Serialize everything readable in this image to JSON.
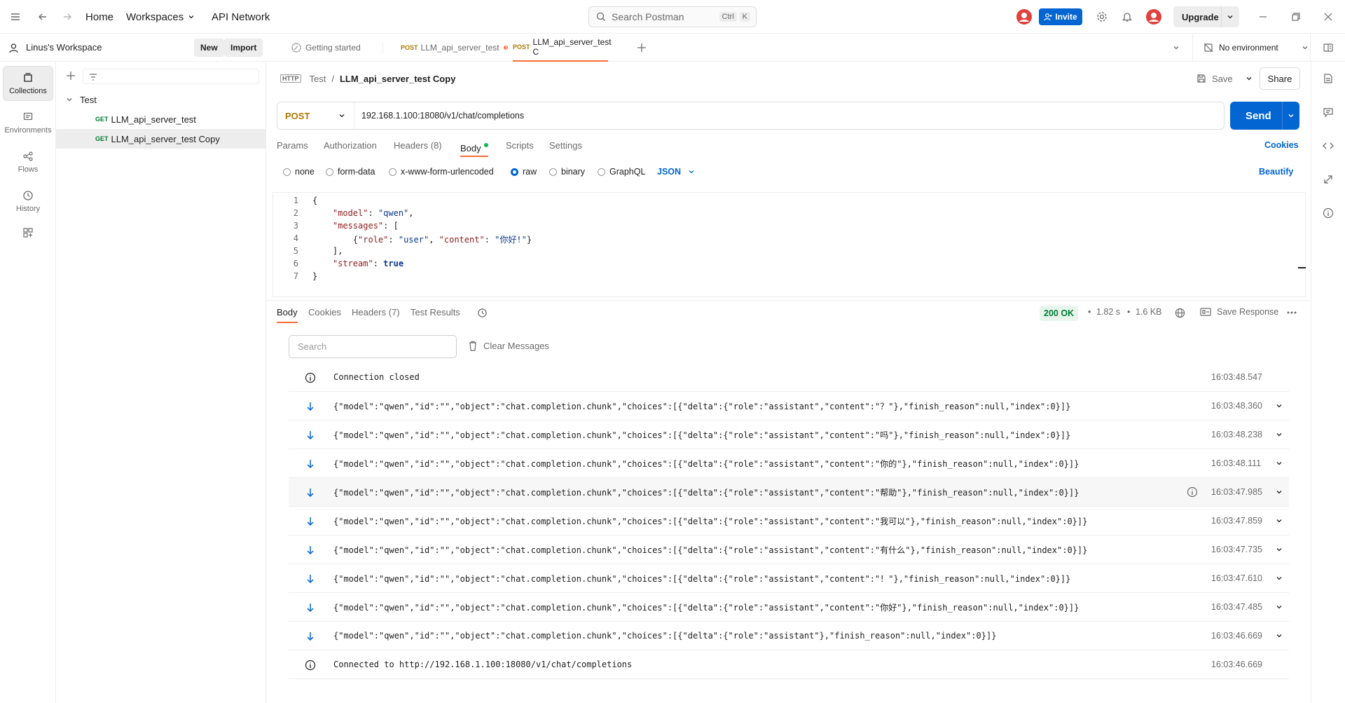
{
  "topbar": {
    "home": "Home",
    "workspaces": "Workspaces",
    "api_network": "API Network",
    "search_placeholder": "Search Postman",
    "kbd_ctrl": "Ctrl",
    "kbd_k": "K",
    "invite": "Invite",
    "upgrade": "Upgrade"
  },
  "rail": {
    "collections": "Collections",
    "environments": "Environments",
    "flows": "Flows",
    "history": "History"
  },
  "sidebar": {
    "workspace_name": "Linus's Workspace",
    "new_label": "New",
    "import_label": "Import",
    "collection": "Test",
    "items": [
      {
        "method": "GET",
        "name": "LLM_api_server_test"
      },
      {
        "method": "GET",
        "name": "LLM_api_server_test Copy"
      }
    ]
  },
  "tabs": [
    {
      "method": "",
      "label": "Getting started"
    },
    {
      "method": "POST",
      "label": "LLM_api_server_test"
    },
    {
      "method": "POST",
      "label": "LLM_api_server_test C"
    }
  ],
  "environment": "No environment",
  "request": {
    "breadcrumb_parent": "Test",
    "breadcrumb_sep": "/",
    "title": "LLM_api_server_test Copy",
    "save": "Save",
    "share": "Share",
    "method": "POST",
    "url": "192.168.1.100:18080/v1/chat/completions",
    "send": "Send",
    "tabs": [
      "Params",
      "Authorization",
      "Headers (8)",
      "Body",
      "Scripts",
      "Settings"
    ],
    "cookies": "Cookies",
    "body_types": [
      "none",
      "form-data",
      "x-www-form-urlencoded",
      "raw",
      "binary",
      "GraphQL"
    ],
    "format": "JSON",
    "beautify": "Beautify",
    "code_lines": [
      {
        "n": "1",
        "html": "{"
      },
      {
        "n": "2",
        "html": "    <span class='k'>\"model\"</span>: <span class='s'>\"qwen\"</span>,"
      },
      {
        "n": "3",
        "html": "    <span class='k'>\"messages\"</span>: ["
      },
      {
        "n": "4",
        "html": "        {<span class='k'>\"role\"</span>: <span class='s'>\"user\"</span>, <span class='k'>\"content\"</span>: <span class='s'>\"你好!\"</span>}"
      },
      {
        "n": "5",
        "html": "    ],"
      },
      {
        "n": "6",
        "html": "    <span class='k'>\"stream\"</span>: <span class='b'>true</span>"
      },
      {
        "n": "7",
        "html": "}"
      }
    ]
  },
  "response": {
    "tabs": [
      "Body",
      "Cookies",
      "Headers (7)",
      "Test Results"
    ],
    "status": "200 OK",
    "time": "1.82 s",
    "size": "1.6 KB",
    "save_response": "Save Response",
    "search_placeholder": "Search",
    "clear_messages": "Clear Messages",
    "messages": [
      {
        "type": "info",
        "text": "Connection closed",
        "time": "16:03:48.547"
      },
      {
        "type": "in",
        "text": "{\"model\":\"qwen\",\"id\":\"\",\"object\":\"chat.completion.chunk\",\"choices\":[{\"delta\":{\"role\":\"assistant\",\"content\":\"？\"},\"finish_reason\":null,\"index\":0}]}",
        "time": "16:03:48.360"
      },
      {
        "type": "in",
        "text": "{\"model\":\"qwen\",\"id\":\"\",\"object\":\"chat.completion.chunk\",\"choices\":[{\"delta\":{\"role\":\"assistant\",\"content\":\"吗\"},\"finish_reason\":null,\"index\":0}]}",
        "time": "16:03:48.238"
      },
      {
        "type": "in",
        "text": "{\"model\":\"qwen\",\"id\":\"\",\"object\":\"chat.completion.chunk\",\"choices\":[{\"delta\":{\"role\":\"assistant\",\"content\":\"你的\"},\"finish_reason\":null,\"index\":0}]}",
        "time": "16:03:48.111"
      },
      {
        "type": "in",
        "text": "{\"model\":\"qwen\",\"id\":\"\",\"object\":\"chat.completion.chunk\",\"choices\":[{\"delta\":{\"role\":\"assistant\",\"content\":\"帮助\"},\"finish_reason\":null,\"index\":0}]}",
        "time": "16:03:47.985"
      },
      {
        "type": "in",
        "text": "{\"model\":\"qwen\",\"id\":\"\",\"object\":\"chat.completion.chunk\",\"choices\":[{\"delta\":{\"role\":\"assistant\",\"content\":\"我可以\"},\"finish_reason\":null,\"index\":0}]}",
        "time": "16:03:47.859"
      },
      {
        "type": "in",
        "text": "{\"model\":\"qwen\",\"id\":\"\",\"object\":\"chat.completion.chunk\",\"choices\":[{\"delta\":{\"role\":\"assistant\",\"content\":\"有什么\"},\"finish_reason\":null,\"index\":0}]}",
        "time": "16:03:47.735"
      },
      {
        "type": "in",
        "text": "{\"model\":\"qwen\",\"id\":\"\",\"object\":\"chat.completion.chunk\",\"choices\":[{\"delta\":{\"role\":\"assistant\",\"content\":\"！\"},\"finish_reason\":null,\"index\":0}]}",
        "time": "16:03:47.610"
      },
      {
        "type": "in",
        "text": "{\"model\":\"qwen\",\"id\":\"\",\"object\":\"chat.completion.chunk\",\"choices\":[{\"delta\":{\"role\":\"assistant\",\"content\":\"你好\"},\"finish_reason\":null,\"index\":0}]}",
        "time": "16:03:47.485"
      },
      {
        "type": "in",
        "text": "{\"model\":\"qwen\",\"id\":\"\",\"object\":\"chat.completion.chunk\",\"choices\":[{\"delta\":{\"role\":\"assistant\"},\"finish_reason\":null,\"index\":0}]}",
        "time": "16:03:46.669"
      },
      {
        "type": "info",
        "text": "Connected to http://192.168.1.100:18080/v1/chat/completions",
        "time": "16:03:46.669"
      }
    ]
  },
  "colors": {
    "accent": "#ff6c37",
    "primary_blue": "#0265d2",
    "get_green": "#007f31",
    "post_orange": "#ad7a03"
  }
}
